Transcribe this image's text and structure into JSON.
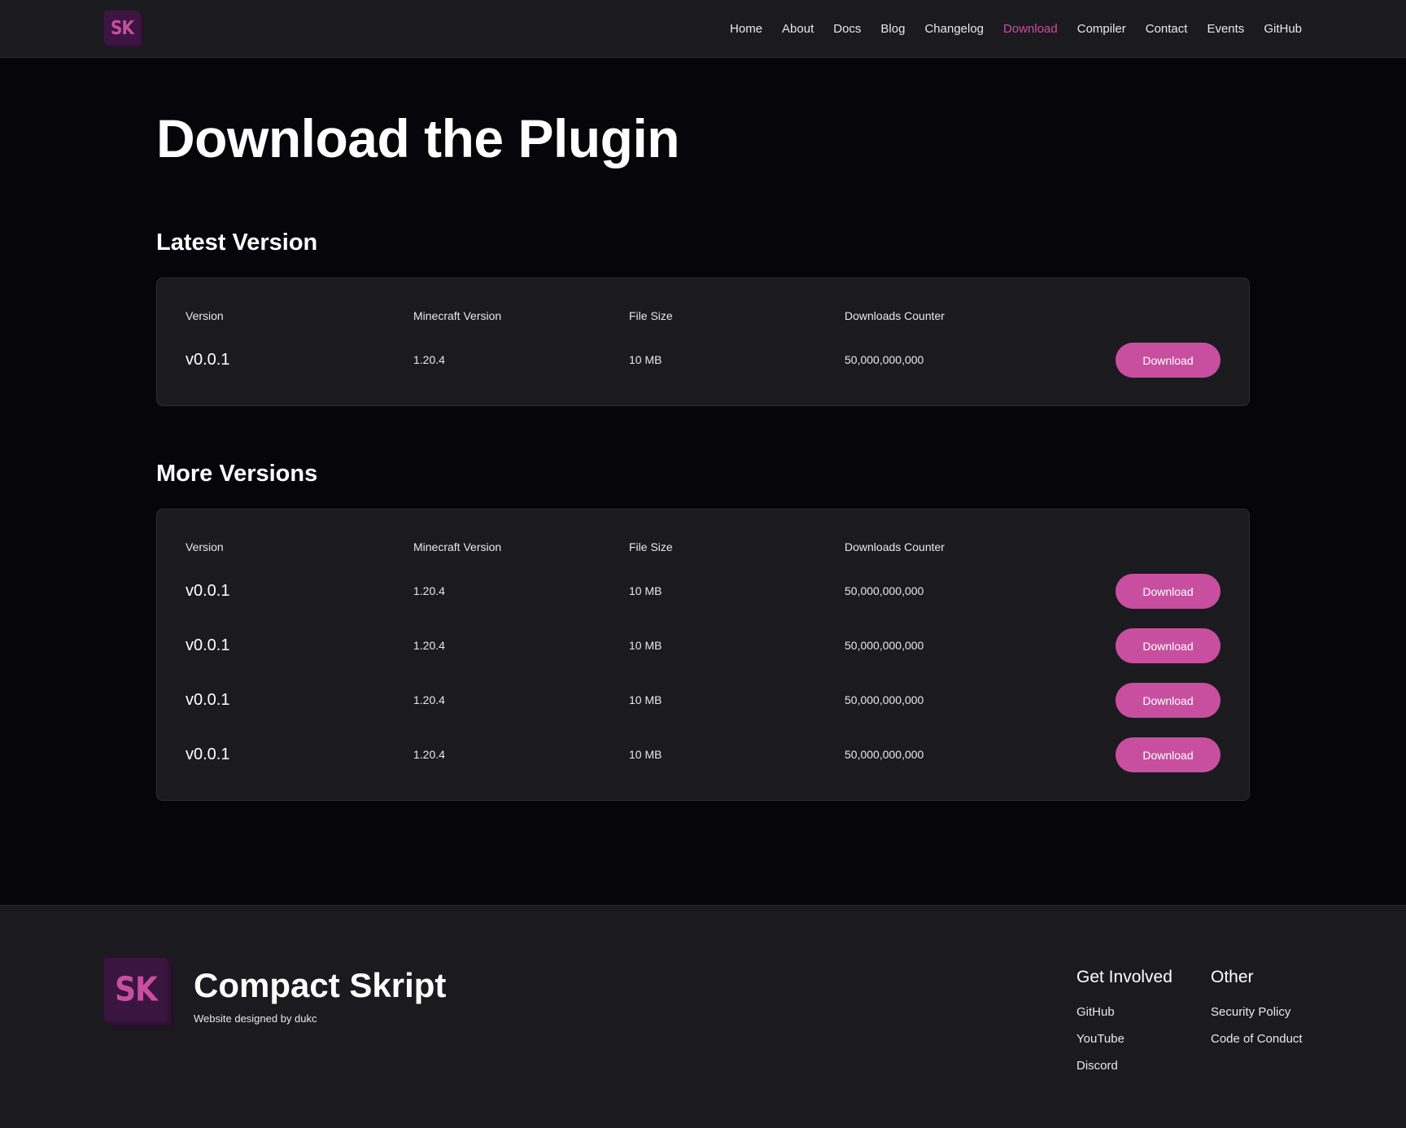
{
  "header": {
    "logo_text": "SK",
    "nav": [
      {
        "label": "Home",
        "active": false
      },
      {
        "label": "About",
        "active": false
      },
      {
        "label": "Docs",
        "active": false
      },
      {
        "label": "Blog",
        "active": false
      },
      {
        "label": "Changelog",
        "active": false
      },
      {
        "label": "Download",
        "active": true
      },
      {
        "label": "Compiler",
        "active": false
      },
      {
        "label": "Contact",
        "active": false
      },
      {
        "label": "Events",
        "active": false
      },
      {
        "label": "GitHub",
        "active": false
      }
    ]
  },
  "main": {
    "title": "Download the Plugin",
    "table_headers": {
      "version": "Version",
      "minecraft": "Minecraft Version",
      "size": "File Size",
      "downloads": "Downloads Counter"
    },
    "latest": {
      "heading": "Latest Version",
      "rows": [
        {
          "version": "v0.0.1",
          "minecraft": "1.20.4",
          "size": "10 MB",
          "downloads": "50,000,000,000",
          "button": "Download"
        }
      ]
    },
    "more": {
      "heading": "More Versions",
      "rows": [
        {
          "version": "v0.0.1",
          "minecraft": "1.20.4",
          "size": "10 MB",
          "downloads": "50,000,000,000",
          "button": "Download"
        },
        {
          "version": "v0.0.1",
          "minecraft": "1.20.4",
          "size": "10 MB",
          "downloads": "50,000,000,000",
          "button": "Download"
        },
        {
          "version": "v0.0.1",
          "minecraft": "1.20.4",
          "size": "10 MB",
          "downloads": "50,000,000,000",
          "button": "Download"
        },
        {
          "version": "v0.0.1",
          "minecraft": "1.20.4",
          "size": "10 MB",
          "downloads": "50,000,000,000",
          "button": "Download"
        }
      ]
    }
  },
  "footer": {
    "logo_text": "SK",
    "brand_name": "Compact Skript",
    "credit": "Website designed by dukc",
    "get_involved": {
      "heading": "Get Involved",
      "links": [
        "GitHub",
        "YouTube",
        "Discord"
      ]
    },
    "other": {
      "heading": "Other",
      "links": [
        "Security Policy",
        "Code of Conduct"
      ]
    }
  },
  "colors": {
    "accent": "#c84f9f",
    "background": "#06060a",
    "surface": "#1b1b1f"
  }
}
